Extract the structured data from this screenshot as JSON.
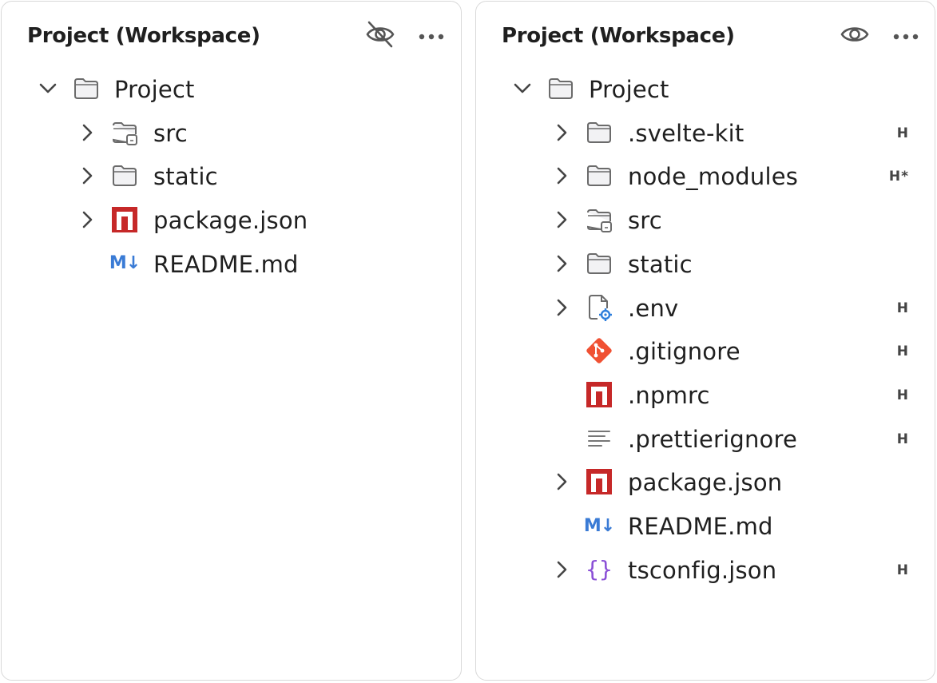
{
  "left_panel": {
    "title": "Project (Workspace)",
    "hidden_toggle_icon": "eye-off-icon",
    "more_icon": "more-horizontal-icon",
    "root": {
      "label": "Project",
      "expanded": true
    },
    "items": [
      {
        "label": "src",
        "icon": "folder-lock-icon",
        "expandable": true,
        "badge": ""
      },
      {
        "label": "static",
        "icon": "folder-icon",
        "expandable": true,
        "badge": ""
      },
      {
        "label": "package.json",
        "icon": "npm-icon",
        "expandable": true,
        "badge": ""
      },
      {
        "label": "README.md",
        "icon": "markdown-icon",
        "expandable": false,
        "badge": ""
      }
    ]
  },
  "right_panel": {
    "title": "Project (Workspace)",
    "hidden_toggle_icon": "eye-icon",
    "more_icon": "more-horizontal-icon",
    "root": {
      "label": "Project",
      "expanded": true
    },
    "items": [
      {
        "label": ".svelte-kit",
        "icon": "folder-icon",
        "expandable": true,
        "badge": "H"
      },
      {
        "label": "node_modules",
        "icon": "folder-icon",
        "expandable": true,
        "badge": "H*"
      },
      {
        "label": "src",
        "icon": "folder-lock-icon",
        "expandable": true,
        "badge": ""
      },
      {
        "label": "static",
        "icon": "folder-icon",
        "expandable": true,
        "badge": ""
      },
      {
        "label": ".env",
        "icon": "settings-file-icon",
        "expandable": true,
        "badge": "H"
      },
      {
        "label": ".gitignore",
        "icon": "git-icon",
        "expandable": false,
        "badge": "H"
      },
      {
        "label": ".npmrc",
        "icon": "npm-icon",
        "expandable": false,
        "badge": "H"
      },
      {
        "label": ".prettierignore",
        "icon": "text-lines-icon",
        "expandable": false,
        "badge": "H"
      },
      {
        "label": "package.json",
        "icon": "npm-icon",
        "expandable": true,
        "badge": ""
      },
      {
        "label": "README.md",
        "icon": "markdown-icon",
        "expandable": false,
        "badge": ""
      },
      {
        "label": "tsconfig.json",
        "icon": "json-braces-icon",
        "expandable": true,
        "badge": "H"
      }
    ]
  },
  "icon_text": {
    "markdown": "M↓",
    "braces": "{}"
  },
  "colors": {
    "npm_red": "#c62828",
    "git_orange": "#f05133",
    "markdown_blue": "#3a7bd5",
    "json_purple": "#8a4fd6",
    "folder_gray": "#6b6b6b",
    "gear_blue": "#2f7fdc"
  }
}
